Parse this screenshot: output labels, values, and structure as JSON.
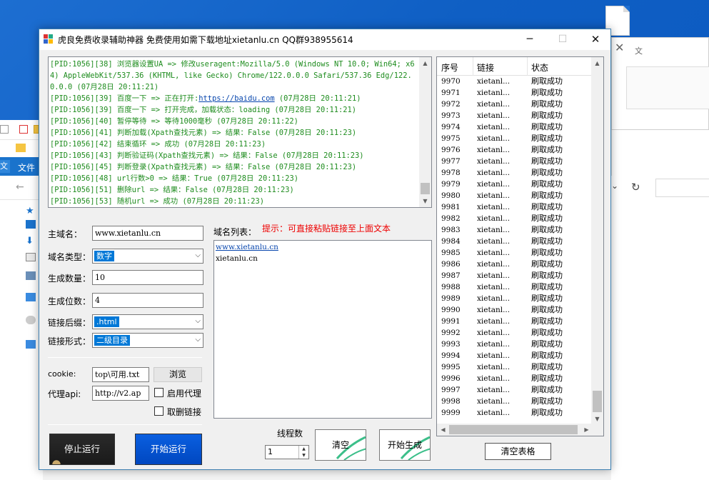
{
  "window": {
    "title": "虎良免费收录辅助神器  免费使用如需下载地址xietanlu.cn QQ群938955614",
    "minimize_glyph": "─",
    "maximize_glyph": "☐",
    "close_glyph": "✕"
  },
  "background": {
    "ribbon_file": "文件",
    "ribbon_letter": "文",
    "dialog_close": "✕",
    "dialog_text": "文",
    "refresh_glyph": "↻",
    "chevron_glyph": "⌄"
  },
  "log": {
    "lines": [
      {
        "text": "[PID:1056][38] 浏览器设置UA => 修改useragent:Mozilla/5.0 (Windows NT 10.0; Win64; x64) AppleWebKit/537.36 (KHTML, like Gecko) Chrome/122.0.0.0 Safari/537.36 Edg/122.0.0.0 (07月28日 20:11:21)"
      },
      {
        "pre": "[PID:1056][39] 百度一下 => 正在打开:",
        "url": "https://baidu.com",
        "post": " (07月28日 20:11:21)"
      },
      {
        "text": "[PID:1056][39] 百度一下 => 打开完成，加载状态：loading (07月28日 20:11:21)"
      },
      {
        "text": "[PID:1056][40] 暂停等待 => 等待1000毫秒 (07月28日 20:11:22)"
      },
      {
        "text": "[PID:1056][41] 判断加载(Xpath查找元素) => 结果：False (07月28日 20:11:23)"
      },
      {
        "text": "[PID:1056][42] 结束循环 => 成功 (07月28日 20:11:23)"
      },
      {
        "text": "[PID:1056][43] 判断验证码(Xpath查找元素) => 结果：False (07月28日 20:11:23)"
      },
      {
        "text": "[PID:1056][45] 判断登录(Xpath查找元素) => 结果：False (07月28日 20:11:23)"
      },
      {
        "text": "[PID:1056][48] url行数>0 => 结果：True (07月28日 20:11:23)"
      },
      {
        "text": "[PID:1056][51] 删除url => 结果：False (07月28日 20:11:23)"
      },
      {
        "text": "[PID:1056][53] 随机url => 成功 (07月28日 20:11:23)"
      }
    ]
  },
  "form": {
    "main_domain_label": "主域名：",
    "main_domain_value": "www.xietanlu.cn",
    "domain_type_label": "域名类型：",
    "domain_type_value": "数字",
    "gen_count_label": "生成数量：",
    "gen_count_value": "10",
    "gen_digits_label": "生成位数：",
    "gen_digits_value": "4",
    "suffix_label": "链接后缀：",
    "suffix_value": ".html",
    "form_label": "链接形式：",
    "form_value": "二级目录",
    "cookie_label": "cookie:",
    "cookie_value": "top\\可用.txt",
    "browse_label": "浏览",
    "proxy_label": "代理api:",
    "proxy_value": "http://v2.ap",
    "use_proxy_label": "启用代理",
    "remove_link_label": "取删链接"
  },
  "domain_list": {
    "label": "域名列表：",
    "tip": "提示：可直接粘贴链接至上面文本",
    "items": [
      "www.xietanlu.cn",
      "xietanlu.cn"
    ]
  },
  "controls": {
    "stop_label": "停止运行",
    "start_label": "开始运行",
    "thread_label": "线程数",
    "thread_value": "1",
    "clear_label": "清空",
    "generate_label": "开始生成",
    "clear_table_label": "清空表格"
  },
  "grid": {
    "headers": [
      "序号",
      "链接",
      "状态"
    ],
    "rows": [
      {
        "n": "9970",
        "u": "xietanl...",
        "s": "刷取成功"
      },
      {
        "n": "9971",
        "u": "xietanl...",
        "s": "刷取成功"
      },
      {
        "n": "9972",
        "u": "xietanl...",
        "s": "刷取成功"
      },
      {
        "n": "9973",
        "u": "xietanl...",
        "s": "刷取成功"
      },
      {
        "n": "9974",
        "u": "xietanl...",
        "s": "刷取成功"
      },
      {
        "n": "9975",
        "u": "xietanl...",
        "s": "刷取成功"
      },
      {
        "n": "9976",
        "u": "xietanl...",
        "s": "刷取成功"
      },
      {
        "n": "9977",
        "u": "xietanl...",
        "s": "刷取成功"
      },
      {
        "n": "9978",
        "u": "xietanl...",
        "s": "刷取成功"
      },
      {
        "n": "9979",
        "u": "xietanl...",
        "s": "刷取成功"
      },
      {
        "n": "9980",
        "u": "xietanl...",
        "s": "刷取成功"
      },
      {
        "n": "9981",
        "u": "xietanl...",
        "s": "刷取成功"
      },
      {
        "n": "9982",
        "u": "xietanl...",
        "s": "刷取成功"
      },
      {
        "n": "9983",
        "u": "xietanl...",
        "s": "刷取成功"
      },
      {
        "n": "9984",
        "u": "xietanl...",
        "s": "刷取成功"
      },
      {
        "n": "9985",
        "u": "xietanl...",
        "s": "刷取成功"
      },
      {
        "n": "9986",
        "u": "xietanl...",
        "s": "刷取成功"
      },
      {
        "n": "9987",
        "u": "xietanl...",
        "s": "刷取成功"
      },
      {
        "n": "9988",
        "u": "xietanl...",
        "s": "刷取成功"
      },
      {
        "n": "9989",
        "u": "xietanl...",
        "s": "刷取成功"
      },
      {
        "n": "9990",
        "u": "xietanl...",
        "s": "刷取成功"
      },
      {
        "n": "9991",
        "u": "xietanl...",
        "s": "刷取成功"
      },
      {
        "n": "9992",
        "u": "xietanl...",
        "s": "刷取成功"
      },
      {
        "n": "9993",
        "u": "xietanl...",
        "s": "刷取成功"
      },
      {
        "n": "9994",
        "u": "xietanl...",
        "s": "刷取成功"
      },
      {
        "n": "9995",
        "u": "xietanl...",
        "s": "刷取成功"
      },
      {
        "n": "9996",
        "u": "xietanl...",
        "s": "刷取成功"
      },
      {
        "n": "9997",
        "u": "xietanl...",
        "s": "刷取成功"
      },
      {
        "n": "9998",
        "u": "xietanl...",
        "s": "刷取成功"
      },
      {
        "n": "9999",
        "u": "xietanl...",
        "s": "刷取成功"
      }
    ]
  },
  "colors": {
    "desktop": "#0f5fc4",
    "log_text": "#1e8c1e",
    "tip_text": "#ee0000",
    "selection": "#0078d7",
    "start_button": "#0047c0"
  }
}
